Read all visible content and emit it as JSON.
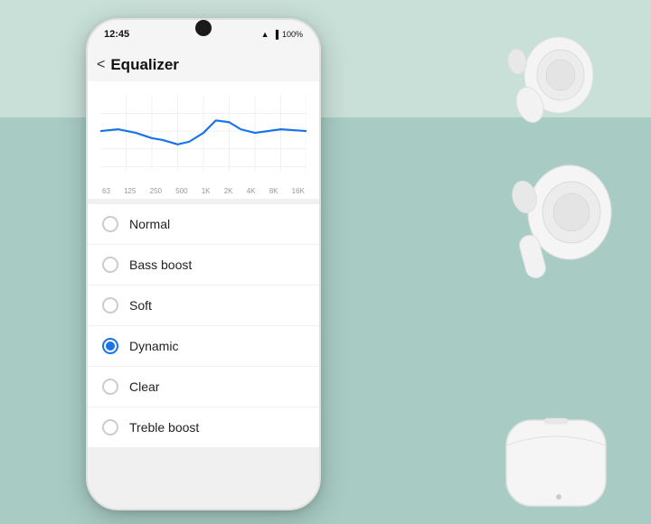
{
  "background": {
    "top_color": "#c8e0d8",
    "bottom_color": "#a8ccc4"
  },
  "phone": {
    "status_bar": {
      "time": "12:45",
      "battery": "100%",
      "signal_icon": "📶"
    },
    "header": {
      "back_label": "‹",
      "title": "Equalizer"
    },
    "chart": {
      "x_labels": [
        "63",
        "125",
        "250",
        "500",
        "1K",
        "2K",
        "4K",
        "8K",
        "16K"
      ]
    },
    "options": [
      {
        "id": "normal",
        "label": "Normal",
        "selected": false
      },
      {
        "id": "bass-boost",
        "label": "Bass boost",
        "selected": false
      },
      {
        "id": "soft",
        "label": "Soft",
        "selected": false
      },
      {
        "id": "dynamic",
        "label": "Dynamic",
        "selected": true
      },
      {
        "id": "clear",
        "label": "Clear",
        "selected": false
      },
      {
        "id": "treble-boost",
        "label": "Treble boost",
        "selected": false
      }
    ]
  }
}
